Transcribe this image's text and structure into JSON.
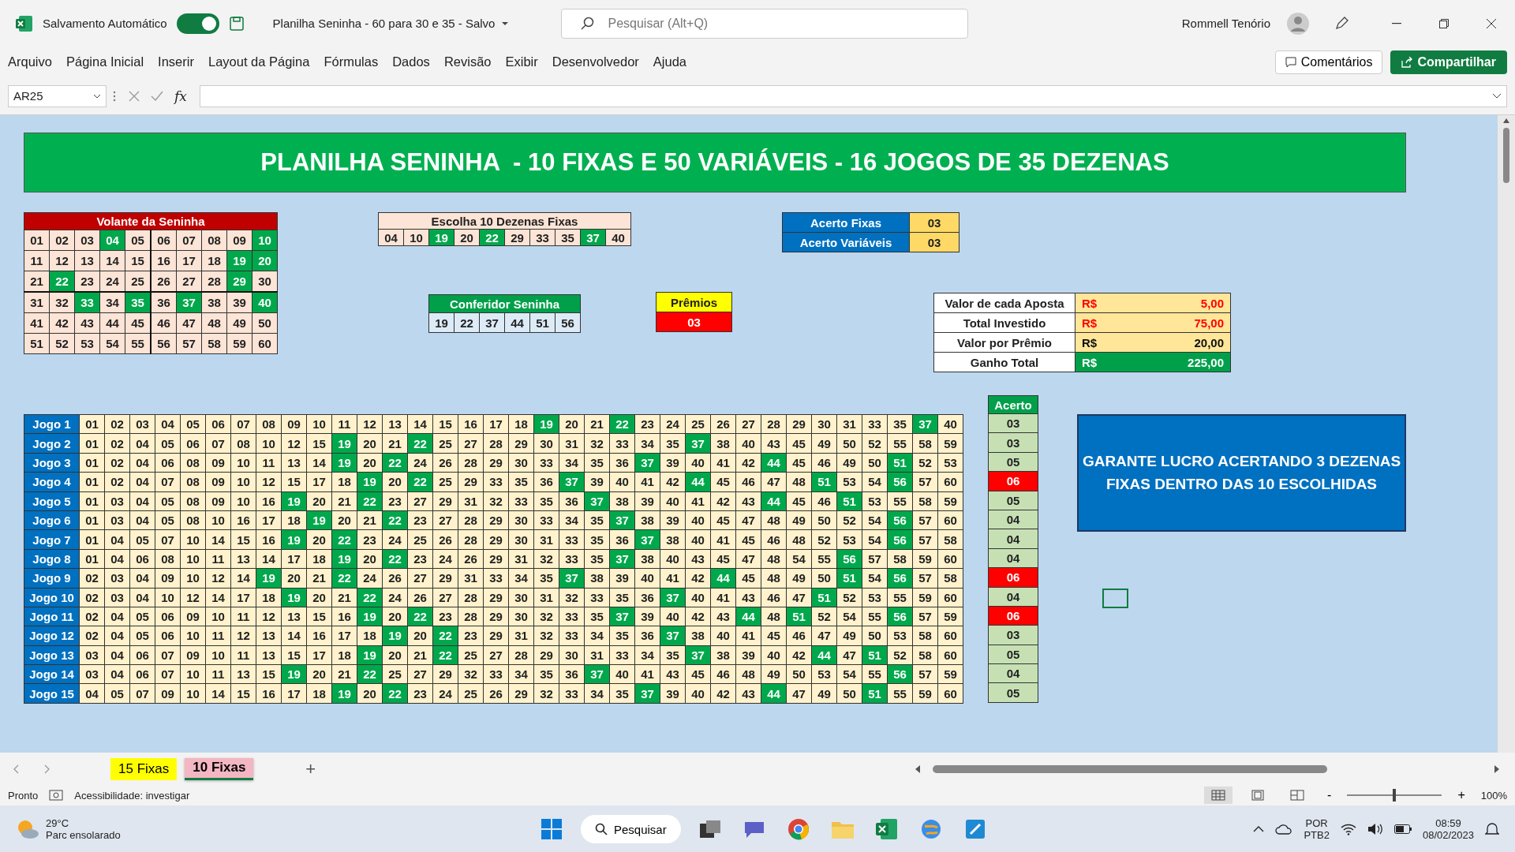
{
  "title_bar": {
    "autosave_label": "Salvamento Automático",
    "autosave_on": true,
    "document_title": "Planilha Seninha - 60 para 30 e 35  -  Salvo",
    "search": {
      "placeholder": "Pesquisar (Alt+Q)"
    },
    "user_name": "Rommell Tenório"
  },
  "menu": {
    "items": [
      "Arquivo",
      "Página Inicial",
      "Inserir",
      "Layout da Página",
      "Fórmulas",
      "Dados",
      "Revisão",
      "Exibir",
      "Desenvolvedor",
      "Ajuda"
    ],
    "comments_button": "Comentários",
    "share_button": "Compartilhar"
  },
  "formula_bar": {
    "name_box": "AR25",
    "function_label": "fx"
  },
  "sheet": {
    "banner": "PLANILHA SENINHA  - 10 FIXAS E 50 VARIÁVEIS - 16 JOGOS DE 35 DEZENAS",
    "volante": {
      "title": "Volante da Seninha",
      "rows": [
        {
          "numbers": [
            "01",
            "02",
            "03",
            "04",
            "05",
            "06",
            "07",
            "08",
            "09",
            "10"
          ],
          "hits": [
            false,
            false,
            false,
            true,
            false,
            false,
            false,
            false,
            false,
            true
          ]
        },
        {
          "numbers": [
            "11",
            "12",
            "13",
            "14",
            "15",
            "16",
            "17",
            "18",
            "19",
            "20"
          ],
          "hits": [
            false,
            false,
            false,
            false,
            false,
            false,
            false,
            false,
            true,
            true
          ]
        },
        {
          "numbers": [
            "21",
            "22",
            "23",
            "24",
            "25",
            "26",
            "27",
            "28",
            "29",
            "30"
          ],
          "hits": [
            false,
            true,
            false,
            false,
            false,
            false,
            false,
            false,
            true,
            false
          ]
        },
        {
          "numbers": [
            "31",
            "32",
            "33",
            "34",
            "35",
            "36",
            "37",
            "38",
            "39",
            "40"
          ],
          "hits": [
            false,
            false,
            true,
            false,
            true,
            false,
            true,
            false,
            false,
            true
          ]
        },
        {
          "numbers": [
            "41",
            "42",
            "43",
            "44",
            "45",
            "46",
            "47",
            "48",
            "49",
            "50"
          ],
          "hits": [
            false,
            false,
            false,
            false,
            false,
            false,
            false,
            false,
            false,
            false
          ]
        },
        {
          "numbers": [
            "51",
            "52",
            "53",
            "54",
            "55",
            "56",
            "57",
            "58",
            "59",
            "60"
          ],
          "hits": [
            false,
            false,
            false,
            false,
            false,
            false,
            false,
            false,
            false,
            false
          ]
        }
      ]
    },
    "fixed_choice": {
      "title": "Escolha 10 Dezenas Fixas",
      "numbers": [
        "04",
        "10",
        "19",
        "20",
        "22",
        "29",
        "33",
        "35",
        "37",
        "40"
      ],
      "hits": [
        false,
        false,
        true,
        false,
        true,
        false,
        false,
        false,
        true,
        false
      ]
    },
    "checker": {
      "title": "Conferidor Seninha",
      "numbers": [
        "19",
        "22",
        "37",
        "44",
        "51",
        "56"
      ]
    },
    "prizes": {
      "title": "Prêmios",
      "value": "03"
    },
    "hits_summary": [
      {
        "label": "Acerto Fixas",
        "value": "03"
      },
      {
        "label": "Acerto Variáveis",
        "value": "03"
      }
    ],
    "values": [
      {
        "label": "Valor de cada Aposta",
        "currency": "R$",
        "amount": "5,00",
        "kind": "cost"
      },
      {
        "label": "Total Investido",
        "currency": "R$",
        "amount": "75,00",
        "kind": "cost"
      },
      {
        "label": "Valor por Prêmio",
        "currency": "R$",
        "amount": "20,00",
        "kind": "prize"
      },
      {
        "label": "Ganho Total",
        "currency": "R$",
        "amount": "225,00",
        "kind": "total"
      }
    ],
    "hits_header": "Acerto",
    "games": [
      {
        "label": "Jogo 1",
        "numbers": [
          "01",
          "02",
          "03",
          "04",
          "05",
          "06",
          "07",
          "08",
          "09",
          "10",
          "11",
          "12",
          "13",
          "14",
          "15",
          "16",
          "17",
          "18",
          "19",
          "20",
          "21",
          "22",
          "23",
          "24",
          "25",
          "26",
          "27",
          "28",
          "29",
          "30",
          "31",
          "33",
          "35",
          "37",
          "40"
        ],
        "hits": [
          false,
          false,
          false,
          false,
          false,
          false,
          false,
          false,
          false,
          false,
          false,
          false,
          false,
          false,
          false,
          false,
          false,
          false,
          true,
          false,
          false,
          true,
          false,
          false,
          false,
          false,
          false,
          false,
          false,
          false,
          false,
          false,
          false,
          true,
          false
        ],
        "result": "03",
        "winner": false
      },
      {
        "label": "Jogo 2",
        "numbers": [
          "01",
          "02",
          "04",
          "05",
          "06",
          "07",
          "08",
          "10",
          "12",
          "15",
          "19",
          "20",
          "21",
          "22",
          "25",
          "27",
          "28",
          "29",
          "30",
          "31",
          "32",
          "33",
          "34",
          "35",
          "37",
          "38",
          "40",
          "43",
          "45",
          "49",
          "50",
          "52",
          "55",
          "58",
          "59"
        ],
        "hits": [
          false,
          false,
          false,
          false,
          false,
          false,
          false,
          false,
          false,
          false,
          true,
          false,
          false,
          true,
          false,
          false,
          false,
          false,
          false,
          false,
          false,
          false,
          false,
          false,
          true,
          false,
          false,
          false,
          false,
          false,
          false,
          false,
          false,
          false,
          false
        ],
        "result": "03",
        "winner": false
      },
      {
        "label": "Jogo 3",
        "numbers": [
          "01",
          "02",
          "04",
          "06",
          "08",
          "09",
          "10",
          "11",
          "13",
          "14",
          "19",
          "20",
          "22",
          "24",
          "26",
          "28",
          "29",
          "30",
          "33",
          "34",
          "35",
          "36",
          "37",
          "39",
          "40",
          "41",
          "42",
          "44",
          "45",
          "46",
          "49",
          "50",
          "51",
          "52",
          "53"
        ],
        "hits": [
          false,
          false,
          false,
          false,
          false,
          false,
          false,
          false,
          false,
          false,
          true,
          false,
          true,
          false,
          false,
          false,
          false,
          false,
          false,
          false,
          false,
          false,
          true,
          false,
          false,
          false,
          false,
          true,
          false,
          false,
          false,
          false,
          true,
          false,
          false
        ],
        "result": "05",
        "winner": false
      },
      {
        "label": "Jogo 4",
        "numbers": [
          "01",
          "02",
          "04",
          "07",
          "08",
          "09",
          "10",
          "12",
          "15",
          "17",
          "18",
          "19",
          "20",
          "22",
          "25",
          "29",
          "33",
          "35",
          "36",
          "37",
          "39",
          "40",
          "41",
          "42",
          "44",
          "45",
          "46",
          "47",
          "48",
          "51",
          "53",
          "54",
          "56",
          "57",
          "60"
        ],
        "hits": [
          false,
          false,
          false,
          false,
          false,
          false,
          false,
          false,
          false,
          false,
          false,
          true,
          false,
          true,
          false,
          false,
          false,
          false,
          false,
          true,
          false,
          false,
          false,
          false,
          true,
          false,
          false,
          false,
          false,
          true,
          false,
          false,
          true,
          false,
          false
        ],
        "result": "06",
        "winner": true
      },
      {
        "label": "Jogo 5",
        "numbers": [
          "01",
          "03",
          "04",
          "05",
          "08",
          "09",
          "10",
          "16",
          "19",
          "20",
          "21",
          "22",
          "23",
          "27",
          "29",
          "31",
          "32",
          "33",
          "35",
          "36",
          "37",
          "38",
          "39",
          "40",
          "41",
          "42",
          "43",
          "44",
          "45",
          "46",
          "51",
          "53",
          "55",
          "58",
          "59"
        ],
        "hits": [
          false,
          false,
          false,
          false,
          false,
          false,
          false,
          false,
          true,
          false,
          false,
          true,
          false,
          false,
          false,
          false,
          false,
          false,
          false,
          false,
          true,
          false,
          false,
          false,
          false,
          false,
          false,
          true,
          false,
          false,
          true,
          false,
          false,
          false,
          false
        ],
        "result": "05",
        "winner": false
      },
      {
        "label": "Jogo 6",
        "numbers": [
          "01",
          "03",
          "04",
          "05",
          "08",
          "10",
          "16",
          "17",
          "18",
          "19",
          "20",
          "21",
          "22",
          "23",
          "27",
          "28",
          "29",
          "30",
          "33",
          "34",
          "35",
          "37",
          "38",
          "39",
          "40",
          "45",
          "47",
          "48",
          "49",
          "50",
          "52",
          "54",
          "56",
          "57",
          "60"
        ],
        "hits": [
          false,
          false,
          false,
          false,
          false,
          false,
          false,
          false,
          false,
          true,
          false,
          false,
          true,
          false,
          false,
          false,
          false,
          false,
          false,
          false,
          false,
          true,
          false,
          false,
          false,
          false,
          false,
          false,
          false,
          false,
          false,
          false,
          true,
          false,
          false
        ],
        "result": "04",
        "winner": false
      },
      {
        "label": "Jogo 7",
        "numbers": [
          "01",
          "04",
          "05",
          "07",
          "10",
          "14",
          "15",
          "16",
          "19",
          "20",
          "22",
          "23",
          "24",
          "25",
          "26",
          "28",
          "29",
          "30",
          "31",
          "33",
          "35",
          "36",
          "37",
          "38",
          "40",
          "41",
          "45",
          "46",
          "48",
          "52",
          "53",
          "54",
          "56",
          "57",
          "58"
        ],
        "hits": [
          false,
          false,
          false,
          false,
          false,
          false,
          false,
          false,
          true,
          false,
          true,
          false,
          false,
          false,
          false,
          false,
          false,
          false,
          false,
          false,
          false,
          false,
          true,
          false,
          false,
          false,
          false,
          false,
          false,
          false,
          false,
          false,
          true,
          false,
          false
        ],
        "result": "04",
        "winner": false
      },
      {
        "label": "Jogo 8",
        "numbers": [
          "01",
          "04",
          "06",
          "08",
          "10",
          "11",
          "13",
          "14",
          "17",
          "18",
          "19",
          "20",
          "22",
          "23",
          "24",
          "26",
          "29",
          "31",
          "32",
          "33",
          "35",
          "37",
          "38",
          "40",
          "43",
          "45",
          "47",
          "48",
          "54",
          "55",
          "56",
          "57",
          "58",
          "59",
          "60"
        ],
        "hits": [
          false,
          false,
          false,
          false,
          false,
          false,
          false,
          false,
          false,
          false,
          true,
          false,
          true,
          false,
          false,
          false,
          false,
          false,
          false,
          false,
          false,
          true,
          false,
          false,
          false,
          false,
          false,
          false,
          false,
          false,
          true,
          false,
          false,
          false,
          false
        ],
        "result": "04",
        "winner": false
      },
      {
        "label": "Jogo 9",
        "numbers": [
          "02",
          "03",
          "04",
          "09",
          "10",
          "12",
          "14",
          "19",
          "20",
          "21",
          "22",
          "24",
          "26",
          "27",
          "29",
          "31",
          "33",
          "34",
          "35",
          "37",
          "38",
          "39",
          "40",
          "41",
          "42",
          "44",
          "45",
          "48",
          "49",
          "50",
          "51",
          "54",
          "56",
          "57",
          "58"
        ],
        "hits": [
          false,
          false,
          false,
          false,
          false,
          false,
          false,
          true,
          false,
          false,
          true,
          false,
          false,
          false,
          false,
          false,
          false,
          false,
          false,
          true,
          false,
          false,
          false,
          false,
          false,
          true,
          false,
          false,
          false,
          false,
          true,
          false,
          true,
          false,
          false
        ],
        "result": "06",
        "winner": true
      },
      {
        "label": "Jogo 10",
        "numbers": [
          "02",
          "03",
          "04",
          "10",
          "12",
          "14",
          "17",
          "18",
          "19",
          "20",
          "21",
          "22",
          "24",
          "26",
          "27",
          "28",
          "29",
          "30",
          "31",
          "32",
          "33",
          "35",
          "36",
          "37",
          "40",
          "41",
          "43",
          "46",
          "47",
          "51",
          "52",
          "53",
          "55",
          "59",
          "60"
        ],
        "hits": [
          false,
          false,
          false,
          false,
          false,
          false,
          false,
          false,
          true,
          false,
          false,
          true,
          false,
          false,
          false,
          false,
          false,
          false,
          false,
          false,
          false,
          false,
          false,
          true,
          false,
          false,
          false,
          false,
          false,
          true,
          false,
          false,
          false,
          false,
          false
        ],
        "result": "04",
        "winner": false
      },
      {
        "label": "Jogo 11",
        "numbers": [
          "02",
          "04",
          "05",
          "06",
          "09",
          "10",
          "11",
          "12",
          "13",
          "15",
          "16",
          "19",
          "20",
          "22",
          "23",
          "28",
          "29",
          "30",
          "32",
          "33",
          "35",
          "37",
          "39",
          "40",
          "42",
          "43",
          "44",
          "48",
          "51",
          "52",
          "54",
          "55",
          "56",
          "57",
          "59"
        ],
        "hits": [
          false,
          false,
          false,
          false,
          false,
          false,
          false,
          false,
          false,
          false,
          false,
          true,
          false,
          true,
          false,
          false,
          false,
          false,
          false,
          false,
          false,
          true,
          false,
          false,
          false,
          false,
          true,
          false,
          true,
          false,
          false,
          false,
          true,
          false,
          false
        ],
        "result": "06",
        "winner": true
      },
      {
        "label": "Jogo 12",
        "numbers": [
          "02",
          "04",
          "05",
          "06",
          "10",
          "11",
          "12",
          "13",
          "14",
          "16",
          "17",
          "18",
          "19",
          "20",
          "22",
          "23",
          "29",
          "31",
          "32",
          "33",
          "34",
          "35",
          "36",
          "37",
          "38",
          "40",
          "41",
          "45",
          "46",
          "47",
          "49",
          "50",
          "53",
          "58",
          "60"
        ],
        "hits": [
          false,
          false,
          false,
          false,
          false,
          false,
          false,
          false,
          false,
          false,
          false,
          false,
          true,
          false,
          true,
          false,
          false,
          false,
          false,
          false,
          false,
          false,
          false,
          true,
          false,
          false,
          false,
          false,
          false,
          false,
          false,
          false,
          false,
          false,
          false
        ],
        "result": "03",
        "winner": false
      },
      {
        "label": "Jogo 13",
        "numbers": [
          "03",
          "04",
          "06",
          "07",
          "09",
          "10",
          "11",
          "13",
          "15",
          "17",
          "18",
          "19",
          "20",
          "21",
          "22",
          "25",
          "27",
          "28",
          "29",
          "30",
          "31",
          "33",
          "34",
          "35",
          "37",
          "38",
          "39",
          "40",
          "42",
          "44",
          "47",
          "51",
          "52",
          "58",
          "60"
        ],
        "hits": [
          false,
          false,
          false,
          false,
          false,
          false,
          false,
          false,
          false,
          false,
          false,
          true,
          false,
          false,
          true,
          false,
          false,
          false,
          false,
          false,
          false,
          false,
          false,
          false,
          true,
          false,
          false,
          false,
          false,
          true,
          false,
          true,
          false,
          false,
          false
        ],
        "result": "05",
        "winner": false
      },
      {
        "label": "Jogo 14",
        "numbers": [
          "03",
          "04",
          "06",
          "07",
          "10",
          "11",
          "13",
          "15",
          "19",
          "20",
          "21",
          "22",
          "25",
          "27",
          "29",
          "32",
          "33",
          "34",
          "35",
          "36",
          "37",
          "40",
          "41",
          "43",
          "45",
          "46",
          "48",
          "49",
          "50",
          "53",
          "54",
          "55",
          "56",
          "57",
          "59"
        ],
        "hits": [
          false,
          false,
          false,
          false,
          false,
          false,
          false,
          false,
          true,
          false,
          false,
          true,
          false,
          false,
          false,
          false,
          false,
          false,
          false,
          false,
          true,
          false,
          false,
          false,
          false,
          false,
          false,
          false,
          false,
          false,
          false,
          false,
          true,
          false,
          false
        ],
        "result": "04",
        "winner": false
      },
      {
        "label": "Jogo 15",
        "numbers": [
          "04",
          "05",
          "07",
          "09",
          "10",
          "14",
          "15",
          "16",
          "17",
          "18",
          "19",
          "20",
          "22",
          "23",
          "24",
          "25",
          "26",
          "29",
          "32",
          "33",
          "34",
          "35",
          "37",
          "39",
          "40",
          "42",
          "43",
          "44",
          "47",
          "49",
          "50",
          "51",
          "55",
          "59",
          "60"
        ],
        "hits": [
          false,
          false,
          false,
          false,
          false,
          false,
          false,
          false,
          false,
          false,
          true,
          false,
          true,
          false,
          false,
          false,
          false,
          false,
          false,
          false,
          false,
          false,
          true,
          false,
          false,
          false,
          false,
          true,
          false,
          false,
          false,
          true,
          false,
          false,
          false
        ],
        "result": "05",
        "winner": false
      }
    ],
    "note": "GARANTE LUCRO ACERTANDO 3 DEZENAS FIXAS DENTRO DAS 10 ESCOLHIDAS"
  },
  "sheet_tabs": [
    {
      "label": "15 Fixas",
      "color": "#ffff00",
      "selected": false
    },
    {
      "label": "10 Fixas",
      "color": "#f4b6c2",
      "selected": true
    }
  ],
  "add_sheet": "+",
  "status_bar": {
    "ready": "Pronto",
    "accessibility": "Acessibilidade: investigar",
    "views": [
      {
        "kind": "normal",
        "selected": true
      },
      {
        "kind": "page_layout",
        "selected": false
      },
      {
        "kind": "page_break",
        "selected": false
      }
    ],
    "zoom_minus": "-",
    "zoom_plus": "+",
    "zoom": {
      "level": 0.5
    },
    "zoom_text": "100%"
  },
  "taskbar": {
    "temperature": "29°C",
    "weather": "Parc ensolarado",
    "search": "Pesquisar",
    "language": "POR",
    "layout": "PTB2",
    "time": "08:59",
    "date": "08/02/2023"
  }
}
